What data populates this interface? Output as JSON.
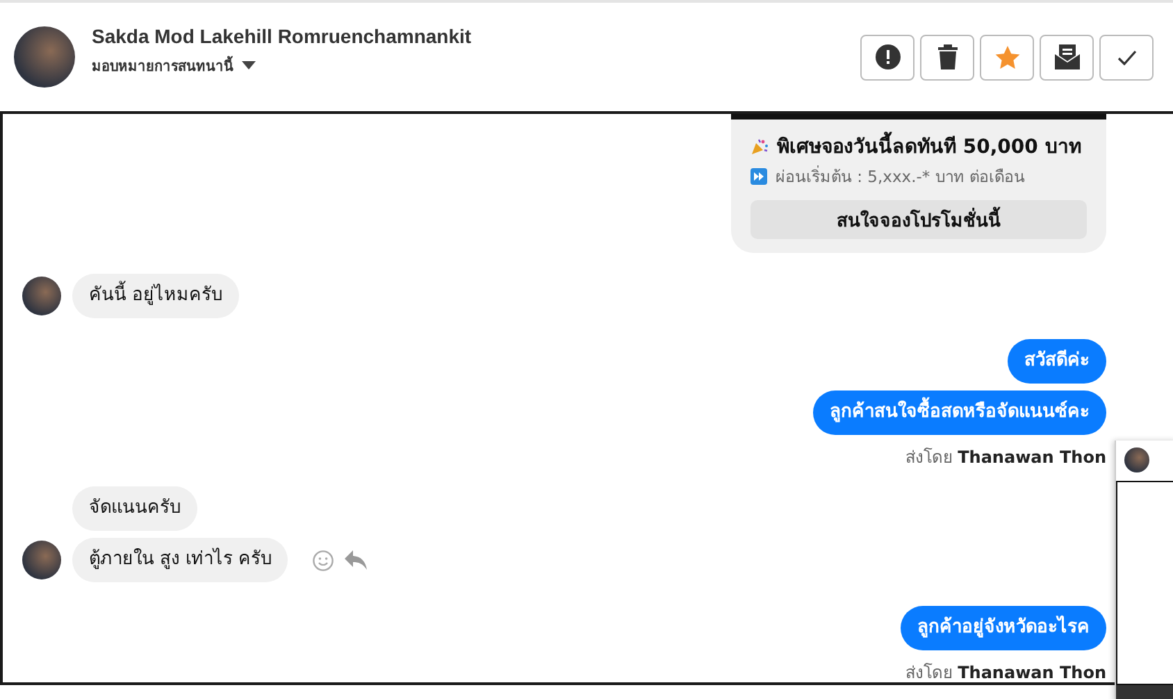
{
  "conversation": {
    "name": "Sakda Mod Lakehill Romruenchamnankit",
    "assign_label": "มอบหมายการสนทนานี้"
  },
  "toolbar_buttons": [
    {
      "kind": "alert",
      "on": false
    },
    {
      "kind": "delete",
      "on": false
    },
    {
      "kind": "star",
      "on": true
    },
    {
      "kind": "mail",
      "on": false
    },
    {
      "kind": "done",
      "on": false
    }
  ],
  "messages": [
    {
      "kind": "promo_card",
      "title": "พิเศษจองวันนี้ลดทันที 50,000 บาท",
      "subtitle": "ผ่อนเริ่มต้น : 5,xxx.-* บาท ต่อเดือน",
      "button": "สนใจจองโปรโมชั่นนี้"
    },
    {
      "kind": "incoming",
      "text": "คันนี้ อยู่ไหมครับ",
      "avatar": true,
      "actions": false
    },
    {
      "kind": "outgoing",
      "text": "สวัสดีค่ะ"
    },
    {
      "kind": "outgoing",
      "text": "ลูกค้าสนใจซื้อสดหรือจัดแนนซ์คะ"
    },
    {
      "kind": "sender_note",
      "text": "ส่งโดย **Thanawan Thon**"
    },
    {
      "kind": "incoming",
      "text": "จัดแนนครับ",
      "avatar": false,
      "actions": false
    },
    {
      "kind": "incoming",
      "text": "ตู้ภายใน สูง เท่าไร ครับ",
      "avatar": true,
      "actions": true
    },
    {
      "kind": "outgoing",
      "text": "ลูกค้าอยู่จังหวัดอะไรค"
    },
    {
      "kind": "sender_note",
      "text": "ส่งโดย **Thanawan Thon**"
    }
  ]
}
